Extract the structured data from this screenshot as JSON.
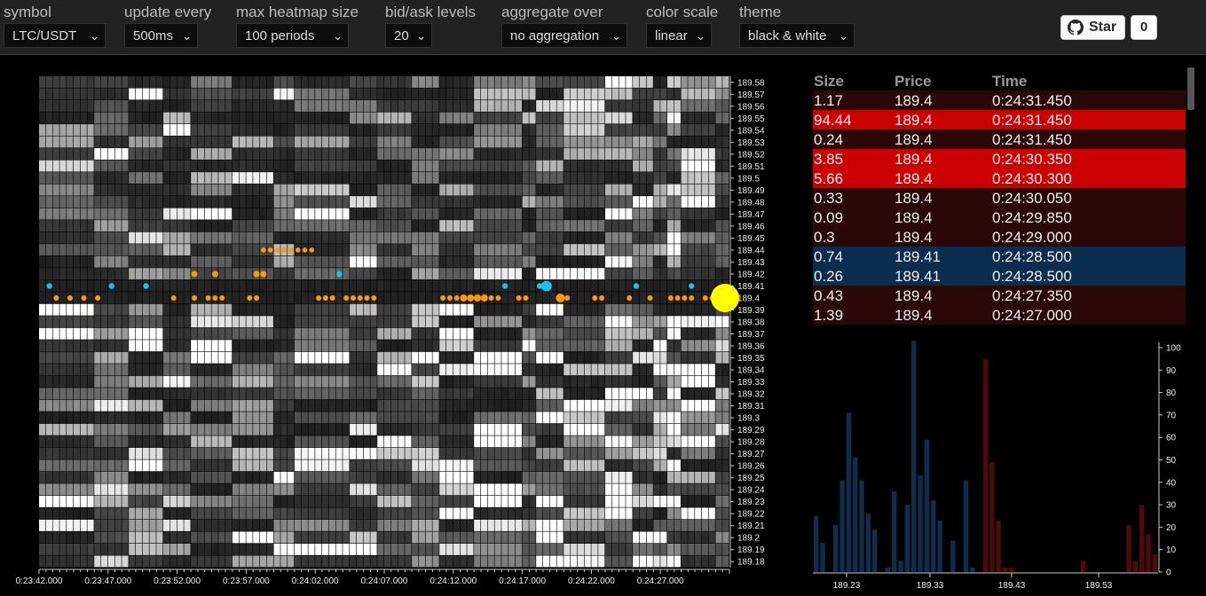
{
  "controls": {
    "symbol": {
      "label": "symbol",
      "value": "LTC/USDT"
    },
    "update": {
      "label": "update every",
      "value": "500ms"
    },
    "heatmap_size": {
      "label": "max heatmap size",
      "value": "100 periods"
    },
    "levels": {
      "label": "bid/ask levels",
      "value": "20"
    },
    "aggregate": {
      "label": "aggregate over",
      "value": "no aggregation"
    },
    "color_scale": {
      "label": "color scale",
      "value": "linear"
    },
    "theme": {
      "label": "theme",
      "value": "black & white"
    }
  },
  "github": {
    "star_label": "Star",
    "count": "0"
  },
  "colors": {
    "sell_strong": "#cc0000",
    "sell_weak": "#2a0808",
    "buy": "#0c2e4e",
    "buy_dot": "#19c2e6",
    "sell_dot": "#ff9a00",
    "last_price": "#ffff00",
    "hist_bid": "#0f2e4e",
    "hist_ask": "#4d0b0b"
  },
  "heatmap": {
    "price_ticks": [
      "189.58",
      "189.57",
      "189.56",
      "189.55",
      "189.54",
      "189.53",
      "189.52",
      "189.51",
      "189.5",
      "189.49",
      "189.48",
      "189.47",
      "189.46",
      "189.45",
      "189.44",
      "189.43",
      "189.42",
      "189.41",
      "189.4",
      "189.39",
      "189.38",
      "189.37",
      "189.36",
      "189.35",
      "189.34",
      "189.33",
      "189.32",
      "189.31",
      "189.3",
      "189.29",
      "189.28",
      "189.27",
      "189.26",
      "189.25",
      "189.24",
      "189.23",
      "189.22",
      "189.21",
      "189.2",
      "189.19",
      "189.18"
    ],
    "time_ticks": [
      "0:23:42.000",
      "0:23:47.000",
      "0:23:52.000",
      "0:23:57.000",
      "0:24:02.000",
      "0:24:07.000",
      "0:24:12.000",
      "0:24:17.000",
      "0:24:22.000",
      "0:24:27.000"
    ]
  },
  "trades": {
    "headers": {
      "size": "Size",
      "price": "Price",
      "time": "Time"
    },
    "rows": [
      {
        "size": "1.17",
        "price": "189.4",
        "time": "0:24:31.450",
        "side": "sell",
        "strong": false
      },
      {
        "size": "94.44",
        "price": "189.4",
        "time": "0:24:31.450",
        "side": "sell",
        "strong": true
      },
      {
        "size": "0.24",
        "price": "189.4",
        "time": "0:24:31.450",
        "side": "sell",
        "strong": false
      },
      {
        "size": "3.85",
        "price": "189.4",
        "time": "0:24:30.350",
        "side": "sell",
        "strong": true
      },
      {
        "size": "5.66",
        "price": "189.4",
        "time": "0:24:30.300",
        "side": "sell",
        "strong": true
      },
      {
        "size": "0.33",
        "price": "189.4",
        "time": "0:24:30.050",
        "side": "sell",
        "strong": false
      },
      {
        "size": "0.09",
        "price": "189.4",
        "time": "0:24:29.850",
        "side": "sell",
        "strong": false
      },
      {
        "size": "0.3",
        "price": "189.4",
        "time": "0:24:29.000",
        "side": "sell",
        "strong": false
      },
      {
        "size": "0.74",
        "price": "189.41",
        "time": "0:24:28.500",
        "side": "buy",
        "strong": false
      },
      {
        "size": "0.26",
        "price": "189.41",
        "time": "0:24:28.500",
        "side": "buy",
        "strong": false
      },
      {
        "size": "0.43",
        "price": "189.4",
        "time": "0:24:27.350",
        "side": "sell",
        "strong": false
      },
      {
        "size": "1.39",
        "price": "189.4",
        "time": "0:24:27.000",
        "side": "sell",
        "strong": false
      }
    ]
  },
  "chart_data": {
    "type": "bar",
    "x_tick_labels": [
      "189.23",
      "189.33",
      "189.43",
      "189.53"
    ],
    "y_ticks": [
      0,
      10,
      20,
      30,
      40,
      50,
      60,
      70,
      80,
      90,
      100
    ],
    "ylim": [
      0,
      100
    ],
    "series": [
      {
        "side": "bid",
        "values": [
          25,
          13,
          0,
          21,
          41,
          71,
          51,
          41,
          26,
          19,
          0,
          2,
          36,
          5,
          30,
          103,
          43,
          59,
          32,
          23,
          0,
          14,
          0,
          41,
          2
        ]
      },
      {
        "side": "ask",
        "values": [
          0,
          95,
          49,
          23,
          2,
          2,
          0,
          0,
          0,
          0,
          0,
          0,
          0,
          0,
          0,
          0,
          5,
          0,
          0,
          0,
          0,
          0,
          0,
          21,
          5,
          30,
          17,
          8
        ]
      }
    ]
  }
}
